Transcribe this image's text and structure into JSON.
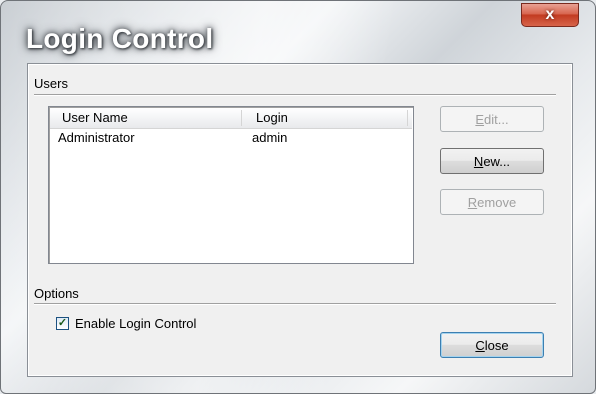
{
  "window": {
    "title": "Login Control",
    "close_glyph": "x",
    "close_icon": "close-icon"
  },
  "users_group": {
    "label": "Users",
    "columns": [
      "User Name",
      "Login"
    ],
    "rows": [
      {
        "user_name": "Administrator",
        "login": "admin"
      }
    ]
  },
  "buttons": {
    "edit": {
      "label": "Edit...",
      "mnemonic": "E",
      "rest": "dit...",
      "enabled": false
    },
    "new": {
      "label": "New...",
      "mnemonic": "N",
      "rest": "ew...",
      "enabled": true
    },
    "remove": {
      "label": "Remove",
      "mnemonic": "R",
      "rest": "emove",
      "enabled": false
    },
    "close": {
      "label": "Close",
      "mnemonic": "C",
      "rest": "lose",
      "enabled": true
    }
  },
  "options_group": {
    "label": "Options",
    "enable_login_control": {
      "label": "Enable Login Control",
      "checked": true,
      "check_glyph": "✓"
    }
  }
}
